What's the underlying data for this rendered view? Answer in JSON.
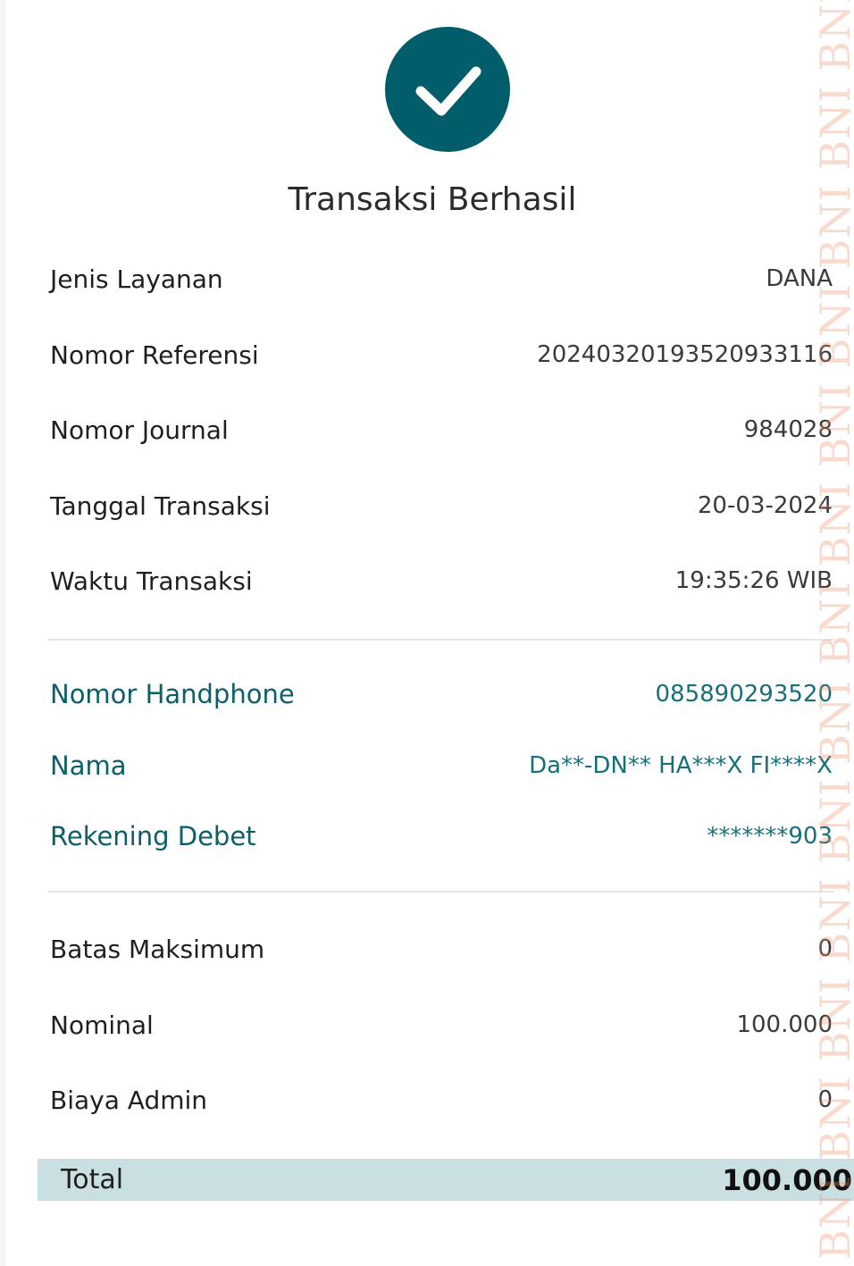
{
  "header": {
    "title": "Transaksi Berhasil",
    "icon": "check-circle-icon",
    "accent_color": "#015d6a"
  },
  "details": [
    {
      "label": "Jenis Layanan",
      "value": "DANA"
    },
    {
      "label": "Nomor Referensi",
      "value": "20240320193520933116"
    },
    {
      "label": "Nomor Journal",
      "value": "984028"
    },
    {
      "label": "Tanggal Transaksi",
      "value": "20-03-2024"
    },
    {
      "label": "Waktu Transaksi",
      "value": "19:35:26 WIB"
    }
  ],
  "recipient": [
    {
      "label": "Nomor Handphone",
      "value": "085890293520"
    },
    {
      "label": "Nama",
      "value": "Da**-DN** HA***X FI****X"
    },
    {
      "label": "Rekening Debet",
      "value": "*******903"
    }
  ],
  "amounts": [
    {
      "label": "Batas Maksimum",
      "value": "0"
    },
    {
      "label": "Nominal",
      "value": "100.000"
    },
    {
      "label": "Biaya Admin",
      "value": "0"
    }
  ],
  "total": {
    "label": "Total",
    "value": "100.000",
    "bar_color": "#c9dfe1"
  },
  "watermark": {
    "text": "BNI BNI BNI BNI BNI BNI BNI BNI BNI BNI BNI BNI BNI BNI BNI BNI BNI BNI",
    "icon": "bni-logo-icon"
  }
}
